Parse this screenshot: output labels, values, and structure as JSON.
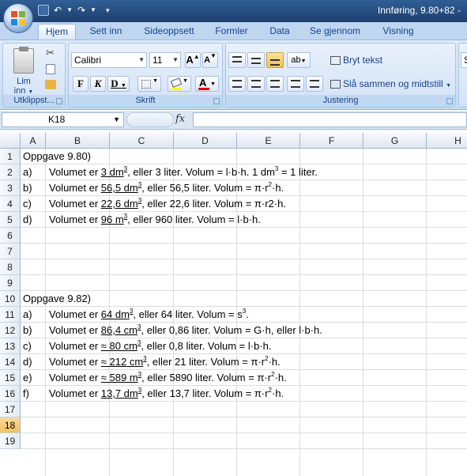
{
  "window": {
    "title": "Innføring, 9.80+82 -"
  },
  "ribbon_tabs": [
    "Hjem",
    "Sett inn",
    "Sideoppsett",
    "Formler",
    "Data",
    "Se gjennom",
    "Visning"
  ],
  "ribbon": {
    "paste_label_1": "Lim",
    "paste_label_2": "inn",
    "clipboard_group": "Utklippst...",
    "font_name": "Calibri",
    "font_size": "11",
    "font_group": "Skrift",
    "bold": "F",
    "italic": "K",
    "underline": "D",
    "wrap_text": "Bryt tekst",
    "merge_center": "Slå sammen og midtstill",
    "alignment_group": "Justering",
    "grow_font": "A",
    "shrink_font": "A",
    "font_color_letter": "A",
    "next_group_letter": "S"
  },
  "formula_bar": {
    "name_box": "K18",
    "fx": "fx",
    "formula": ""
  },
  "columns": [
    "A",
    "B",
    "C",
    "D",
    "E",
    "F",
    "G",
    "H"
  ],
  "rows": [
    {
      "num": "1",
      "a": "Oppgave 9.80)",
      "b": []
    },
    {
      "num": "2",
      "a": "a)",
      "b": [
        {
          "t": "Volumet er "
        },
        {
          "t": "3 dm",
          "u": true
        },
        {
          "t": "3",
          "sup": true,
          "u": true
        },
        {
          "t": ", eller 3 liter. Volum = l·b·h. 1 dm"
        },
        {
          "t": "3",
          "sup": true
        },
        {
          "t": " = 1 liter."
        }
      ]
    },
    {
      "num": "3",
      "a": "b)",
      "b": [
        {
          "t": "Volumet er "
        },
        {
          "t": "56,5 dm",
          "u": true
        },
        {
          "t": "3",
          "sup": true,
          "u": true
        },
        {
          "t": ", eller 56,5 liter. Volum = π·r"
        },
        {
          "t": "2",
          "sup": true
        },
        {
          "t": "·h."
        }
      ]
    },
    {
      "num": "4",
      "a": "c)",
      "b": [
        {
          "t": "Volumet er "
        },
        {
          "t": "22,6 dm",
          "u": true
        },
        {
          "t": "3",
          "sup": true,
          "u": true
        },
        {
          "t": ", eller 22,6 liter. Volum = π·r2·h."
        }
      ]
    },
    {
      "num": "5",
      "a": "d)",
      "b": [
        {
          "t": "Volumet er "
        },
        {
          "t": "96 m",
          "u": true
        },
        {
          "t": "3",
          "sup": true,
          "u": true
        },
        {
          "t": ", eller 960 liter. Volum = l·b·h."
        }
      ]
    },
    {
      "num": "6",
      "a": "",
      "b": []
    },
    {
      "num": "7",
      "a": "",
      "b": []
    },
    {
      "num": "8",
      "a": "",
      "b": []
    },
    {
      "num": "9",
      "a": "",
      "b": []
    },
    {
      "num": "10",
      "a": "Oppgave 9.82)",
      "b": []
    },
    {
      "num": "11",
      "a": "a)",
      "b": [
        {
          "t": "Volumet er "
        },
        {
          "t": "64 dm",
          "u": true
        },
        {
          "t": "3",
          "sup": true,
          "u": true
        },
        {
          "t": ", eller 64 liter. Volum = s"
        },
        {
          "t": "3",
          "sup": true
        },
        {
          "t": "."
        }
      ]
    },
    {
      "num": "12",
      "a": "b)",
      "b": [
        {
          "t": "Volumet er "
        },
        {
          "t": "86,4 cm",
          "u": true
        },
        {
          "t": "3",
          "sup": true,
          "u": true
        },
        {
          "t": ", eller 0,86 liter. Volum = G·h, eller l·b·h."
        }
      ]
    },
    {
      "num": "13",
      "a": "c)",
      "b": [
        {
          "t": "Volumet er "
        },
        {
          "t": "≈ 80 cm",
          "u": true
        },
        {
          "t": "3",
          "sup": true,
          "u": true
        },
        {
          "t": ", eller 0,8 liter. Volum = l·b·h."
        }
      ]
    },
    {
      "num": "14",
      "a": "d)",
      "b": [
        {
          "t": "Volumet er "
        },
        {
          "t": "≈ 212 cm",
          "u": true
        },
        {
          "t": "3",
          "sup": true,
          "u": true
        },
        {
          "t": ", eller 21 liter. Volum = π·r"
        },
        {
          "t": "2",
          "sup": true
        },
        {
          "t": "·h."
        }
      ]
    },
    {
      "num": "15",
      "a": "e)",
      "b": [
        {
          "t": "Volumet er "
        },
        {
          "t": "≈ 589 m",
          "u": true
        },
        {
          "t": "3",
          "sup": true,
          "u": true
        },
        {
          "t": ", eller 5890 liter. Volum = π·r"
        },
        {
          "t": "2",
          "sup": true
        },
        {
          "t": "·h."
        }
      ]
    },
    {
      "num": "16",
      "a": "f)",
      "b": [
        {
          "t": "Volumet er "
        },
        {
          "t": "13,7 dm",
          "u": true
        },
        {
          "t": "3",
          "sup": true,
          "u": true
        },
        {
          "t": ", eller 13,7 liter. Volum = π·r"
        },
        {
          "t": "2",
          "sup": true
        },
        {
          "t": "·h."
        }
      ]
    },
    {
      "num": "17",
      "a": "",
      "b": []
    },
    {
      "num": "18",
      "a": "",
      "b": []
    },
    {
      "num": "19",
      "a": "",
      "b": []
    }
  ],
  "selected_row": "18",
  "icons": [
    "office-logo-icon",
    "save-icon",
    "undo-icon",
    "redo-icon",
    "customize-qat-icon",
    "paste-icon",
    "cut-icon",
    "copy-icon",
    "format-painter-icon",
    "border-icon",
    "fill-color-icon",
    "font-color-icon",
    "align-top-icon",
    "align-middle-icon",
    "align-bottom-icon",
    "orientation-icon",
    "align-left-icon",
    "align-center-icon",
    "align-right-icon",
    "decrease-indent-icon",
    "increase-indent-icon",
    "wrap-text-icon",
    "merge-icon",
    "fx-icon"
  ]
}
